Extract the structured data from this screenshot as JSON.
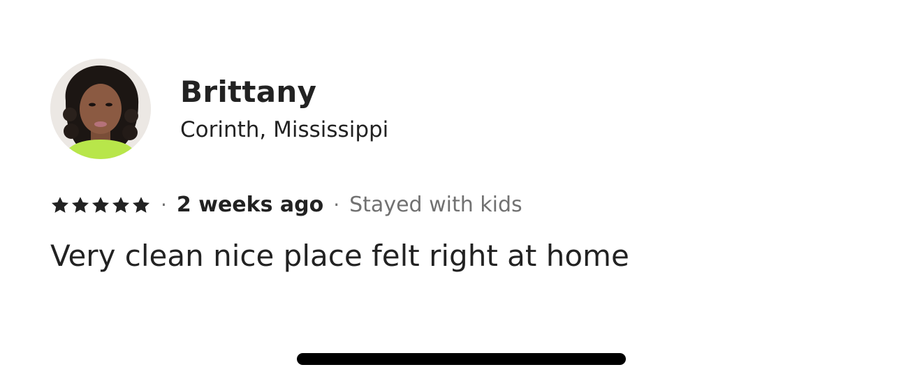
{
  "reviewer": {
    "name": "Brittany",
    "location": "Corinth, Mississippi",
    "avatar_icon": "profile-photo"
  },
  "review": {
    "rating": 5,
    "rating_max": 5,
    "star_icon": "star-icon",
    "separator": "·",
    "date": "2 weeks ago",
    "stay_type": "Stayed with kids",
    "text": "Very clean nice place felt right at home"
  },
  "colors": {
    "text_primary": "#222222",
    "text_secondary": "#717171",
    "home_indicator": "#000000"
  }
}
